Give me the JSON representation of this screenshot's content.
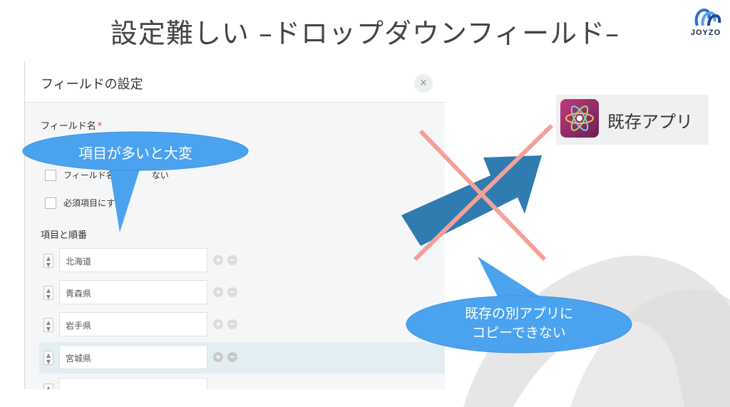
{
  "slide": {
    "title": "設定難しい –ドロップダウンフィールド–"
  },
  "logo": {
    "text": "JOYZO"
  },
  "dialog": {
    "title": "フィールドの設定",
    "close_icon": "×",
    "field_name_label": "フィールド名",
    "required_mark": "*",
    "checkbox_hide_label": "フィールド名",
    "checkbox_hide_label_tail": "ない",
    "checkbox_required_label": "必須項目にす",
    "section_label": "項目と順番",
    "options": [
      {
        "value": "北海道",
        "highlighted": false
      },
      {
        "value": "青森県",
        "highlighted": false
      },
      {
        "value": "岩手県",
        "highlighted": false
      },
      {
        "value": "宮城県",
        "highlighted": true
      }
    ],
    "add_icon": "+",
    "remove_icon": "−"
  },
  "callouts": {
    "many_items": "項目が多いと大変",
    "cannot_copy_line1": "既存の別アプリに",
    "cannot_copy_line2": "コピーできない"
  },
  "app_tile": {
    "name": "既存アプリ",
    "icon": "atom-icon"
  },
  "colors": {
    "callout_blue": "#4ba3f0",
    "arrow_blue": "#2e7cb0",
    "cross_salmon": "#f4a098",
    "highlight_row": "#e3eef2",
    "app_icon_bg": "#9e2b67"
  }
}
